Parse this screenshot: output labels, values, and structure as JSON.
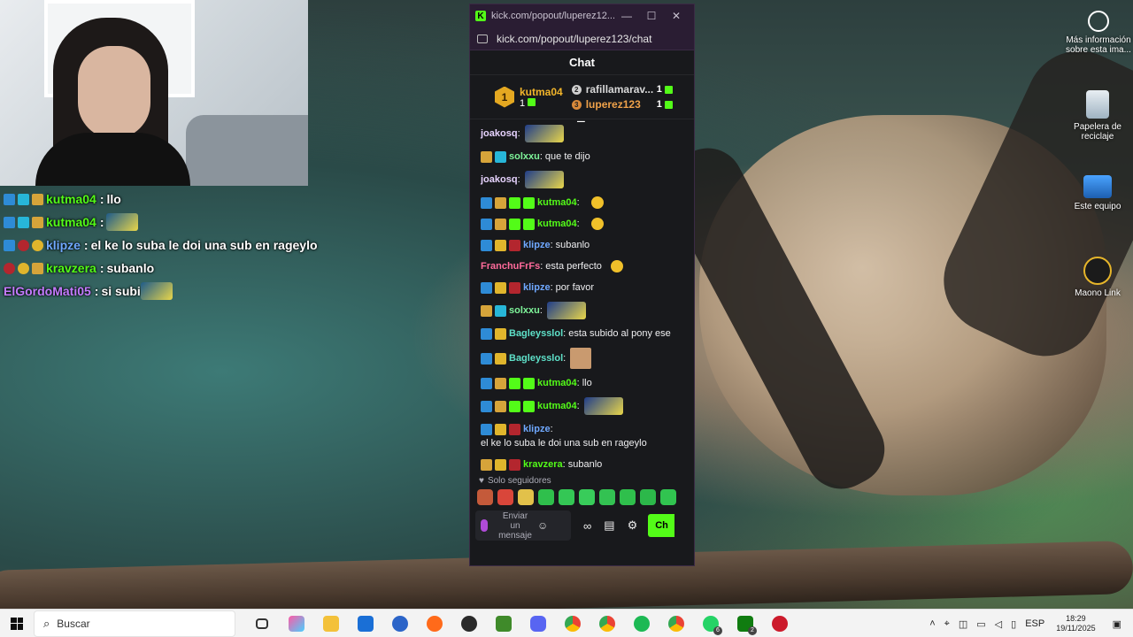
{
  "popout": {
    "title": "kick.com/popout/luperez12...",
    "url": "kick.com/popout/luperez123/chat",
    "chat_title": "Chat",
    "leaderboard": {
      "first": {
        "rank": "1",
        "name": "kutma04",
        "count": "1"
      },
      "others": [
        {
          "rank": "2",
          "name": "rafillamarav...",
          "count": "1",
          "color": "#d8d8d8"
        },
        {
          "rank": "3",
          "name": "luperez123",
          "count": "1",
          "color": "#f0a24a"
        }
      ]
    },
    "messages": [
      {
        "user": "joakosq",
        "color": "#e7d3ff",
        "text": "",
        "emote": "wide",
        "badges": []
      },
      {
        "user": "solxxu",
        "color": "#7ef59a",
        "text": "que te dijo",
        "emote": "",
        "badges": [
          "crown",
          "cyan"
        ]
      },
      {
        "user": "joakosq",
        "color": "#e7d3ff",
        "text": "",
        "emote": "wide",
        "badges": []
      },
      {
        "user": "kutma04",
        "color": "#53fc18",
        "text": "",
        "emote": "face",
        "badges": [
          "blue",
          "crown",
          "green",
          "bot"
        ]
      },
      {
        "user": "kutma04",
        "color": "#53fc18",
        "text": "",
        "emote": "face",
        "badges": [
          "blue",
          "crown",
          "green",
          "bot"
        ]
      },
      {
        "user": "klipze",
        "color": "#6fa8ff",
        "text": "subanlo",
        "emote": "",
        "badges": [
          "blue",
          "gold",
          "red"
        ]
      },
      {
        "user": "FranchuFrFs",
        "color": "#ff6b9b",
        "text": "esta perfecto",
        "emote": "face",
        "badges": []
      },
      {
        "user": "klipze",
        "color": "#6fa8ff",
        "text": "por favor",
        "emote": "",
        "badges": [
          "blue",
          "gold",
          "red"
        ]
      },
      {
        "user": "solxxu",
        "color": "#7ef59a",
        "text": "",
        "emote": "wide",
        "badges": [
          "crown",
          "cyan"
        ]
      },
      {
        "user": "Bagleysslol",
        "color": "#5ee0c8",
        "text": "esta subido al pony ese",
        "emote": "",
        "badges": [
          "blue",
          "gold"
        ]
      },
      {
        "user": "Bagleysslol",
        "color": "#5ee0c8",
        "text": "",
        "emote": "square",
        "badges": [
          "blue",
          "gold"
        ]
      },
      {
        "user": "kutma04",
        "color": "#53fc18",
        "text": "llo",
        "emote": "",
        "badges": [
          "blue",
          "crown",
          "green",
          "bot"
        ]
      },
      {
        "user": "kutma04",
        "color": "#53fc18",
        "text": "",
        "emote": "wide",
        "badges": [
          "blue",
          "crown",
          "green",
          "bot"
        ]
      },
      {
        "user": "klipze",
        "color": "#6fa8ff",
        "text": "el ke lo suba le doi una sub en rageylo",
        "emote": "",
        "badges": [
          "blue",
          "gold",
          "red"
        ]
      },
      {
        "user": "kravzera",
        "color": "#53fc18",
        "text": "subanlo",
        "emote": "",
        "badges": [
          "crown",
          "gold",
          "red"
        ]
      },
      {
        "user": "ElGordoMati05",
        "color": "#c47bff",
        "text": "si subi",
        "emote": "wide",
        "badges": []
      }
    ],
    "followers_only": "Solo seguidores",
    "input_placeholder": "Enviar un mensaje",
    "send_label": "Ch"
  },
  "overlay": [
    {
      "user": "kutma04",
      "color": "#53fc18",
      "text": "llo",
      "emote": false,
      "badges": [
        "blue",
        "cyan",
        "crown"
      ]
    },
    {
      "user": "kutma04",
      "color": "#53fc18",
      "text": "",
      "emote": true,
      "badges": [
        "blue",
        "cyan",
        "crown"
      ]
    },
    {
      "user": "klipze",
      "color": "#6fa8ff",
      "text": "el ke lo suba le doi una sub en rageylo",
      "emote": false,
      "badges": [
        "blue",
        "red",
        "gold"
      ]
    },
    {
      "user": "kravzera",
      "color": "#53fc18",
      "text": "subanlo",
      "emote": false,
      "badges": [
        "red",
        "gold",
        "crown"
      ]
    },
    {
      "user": "ElGordoMati05",
      "color": "#c47bff",
      "text": "si subi",
      "emote": true,
      "badges": []
    }
  ],
  "desktop": {
    "info_label": "Más información sobre esta ima...",
    "recycle_label": "Papelera de reciclaje",
    "pc_label": "Este equipo",
    "maono_label": "Maono Link"
  },
  "taskbar": {
    "search_placeholder": "Buscar",
    "lang": "ESP",
    "time": "18:29",
    "date": "19/11/2025",
    "whatsapp_count": "6",
    "xbox_count": "2"
  }
}
